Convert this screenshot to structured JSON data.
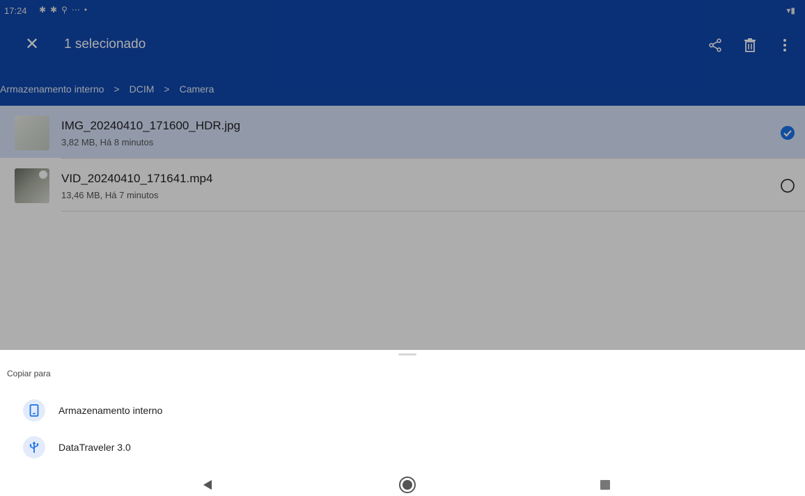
{
  "status_bar": {
    "time": "17:24"
  },
  "app_bar": {
    "selection_title": "1 selecionado",
    "close_icon": "close-icon",
    "actions": [
      "share-icon",
      "delete-icon",
      "more-vert-icon"
    ],
    "color": "#0f47af"
  },
  "breadcrumb": {
    "items": [
      "Armazenamento interno",
      "DCIM",
      "Camera"
    ]
  },
  "files": [
    {
      "name": "IMG_20240410_171600_HDR.jpg",
      "meta": "3,82 MB, Há 8 minutos",
      "selected": true
    },
    {
      "name": "VID_20240410_171641.mp4",
      "meta": "13,46 MB, Há 7 minutos",
      "selected": false
    }
  ],
  "sheet": {
    "title": "Copiar para",
    "destinations": [
      {
        "label": "Armazenamento interno",
        "icon": "phone-icon"
      },
      {
        "label": "DataTraveler 3.0",
        "icon": "usb-icon"
      }
    ]
  },
  "nav": {
    "icons": [
      "back-icon",
      "home-icon",
      "recents-icon"
    ]
  },
  "colors": {
    "accent": "#1a73e8",
    "selected_row": "#d7e3fb"
  }
}
